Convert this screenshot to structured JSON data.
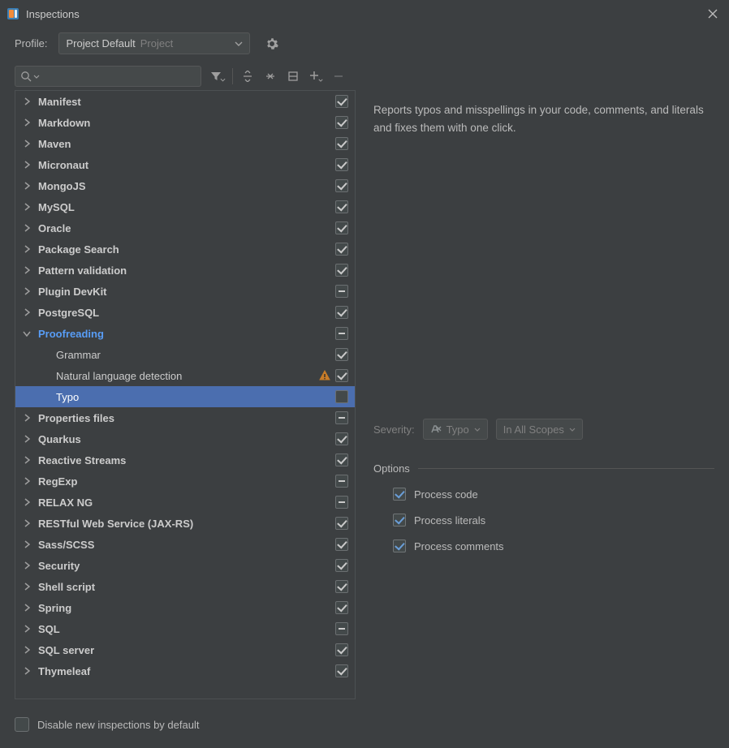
{
  "window": {
    "title": "Inspections"
  },
  "profile": {
    "label": "Profile:",
    "value": "Project Default",
    "scope": "Project"
  },
  "search": {
    "placeholder": ""
  },
  "tree": [
    {
      "label": "Manifest",
      "level": 0,
      "expand": "closed",
      "bold": true,
      "check": "checked"
    },
    {
      "label": "Markdown",
      "level": 0,
      "expand": "closed",
      "bold": true,
      "check": "checked"
    },
    {
      "label": "Maven",
      "level": 0,
      "expand": "closed",
      "bold": true,
      "check": "checked"
    },
    {
      "label": "Micronaut",
      "level": 0,
      "expand": "closed",
      "bold": true,
      "check": "checked"
    },
    {
      "label": "MongoJS",
      "level": 0,
      "expand": "closed",
      "bold": true,
      "check": "checked"
    },
    {
      "label": "MySQL",
      "level": 0,
      "expand": "closed",
      "bold": true,
      "check": "checked"
    },
    {
      "label": "Oracle",
      "level": 0,
      "expand": "closed",
      "bold": true,
      "check": "checked"
    },
    {
      "label": "Package Search",
      "level": 0,
      "expand": "closed",
      "bold": true,
      "check": "checked"
    },
    {
      "label": "Pattern validation",
      "level": 0,
      "expand": "closed",
      "bold": true,
      "check": "checked"
    },
    {
      "label": "Plugin DevKit",
      "level": 0,
      "expand": "closed",
      "bold": true,
      "check": "mixed"
    },
    {
      "label": "PostgreSQL",
      "level": 0,
      "expand": "closed",
      "bold": true,
      "check": "checked"
    },
    {
      "label": "Proofreading",
      "level": 0,
      "expand": "open",
      "bold": true,
      "blue": true,
      "check": "mixed"
    },
    {
      "label": "Grammar",
      "level": 1,
      "expand": "none",
      "check": "checked"
    },
    {
      "label": "Natural language detection",
      "level": 1,
      "expand": "none",
      "check": "checked",
      "warn": true
    },
    {
      "label": "Typo",
      "level": 1,
      "expand": "none",
      "check": "off",
      "selected": true
    },
    {
      "label": "Properties files",
      "level": 0,
      "expand": "closed",
      "bold": true,
      "check": "mixed"
    },
    {
      "label": "Quarkus",
      "level": 0,
      "expand": "closed",
      "bold": true,
      "check": "checked"
    },
    {
      "label": "Reactive Streams",
      "level": 0,
      "expand": "closed",
      "bold": true,
      "check": "checked"
    },
    {
      "label": "RegExp",
      "level": 0,
      "expand": "closed",
      "bold": true,
      "check": "mixed"
    },
    {
      "label": "RELAX NG",
      "level": 0,
      "expand": "closed",
      "bold": true,
      "check": "mixed"
    },
    {
      "label": "RESTful Web Service (JAX-RS)",
      "level": 0,
      "expand": "closed",
      "bold": true,
      "check": "checked"
    },
    {
      "label": "Sass/SCSS",
      "level": 0,
      "expand": "closed",
      "bold": true,
      "check": "checked"
    },
    {
      "label": "Security",
      "level": 0,
      "expand": "closed",
      "bold": true,
      "check": "checked"
    },
    {
      "label": "Shell script",
      "level": 0,
      "expand": "closed",
      "bold": true,
      "check": "checked"
    },
    {
      "label": "Spring",
      "level": 0,
      "expand": "closed",
      "bold": true,
      "check": "checked"
    },
    {
      "label": "SQL",
      "level": 0,
      "expand": "closed",
      "bold": true,
      "check": "mixed"
    },
    {
      "label": "SQL server",
      "level": 0,
      "expand": "closed",
      "bold": true,
      "check": "checked"
    },
    {
      "label": "Thymeleaf",
      "level": 0,
      "expand": "closed",
      "bold": true,
      "check": "checked"
    }
  ],
  "detail": {
    "description": "Reports typos and misspellings in your code, comments, and literals and fixes them with one click.",
    "severity_label": "Severity:",
    "severity_value": "Typo",
    "scope_value": "In All Scopes",
    "options_header": "Options",
    "options": [
      {
        "label": "Process code",
        "checked": true
      },
      {
        "label": "Process literals",
        "checked": true
      },
      {
        "label": "Process comments",
        "checked": true
      }
    ]
  },
  "footer": {
    "disable_label": "Disable new inspections by default",
    "disable_checked": false
  }
}
